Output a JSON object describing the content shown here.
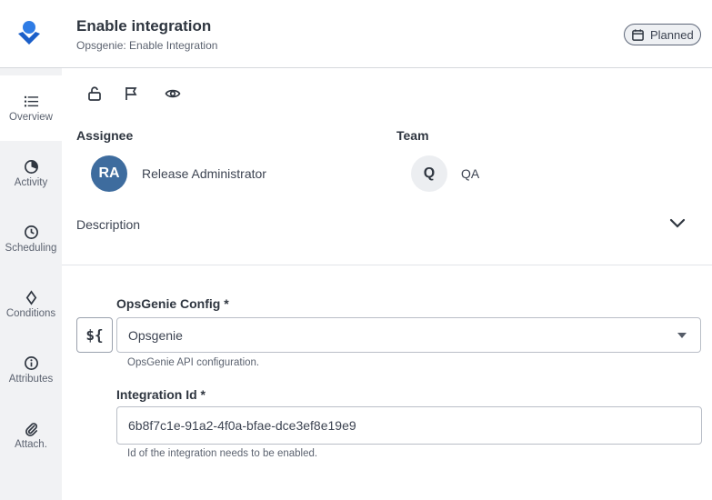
{
  "header": {
    "title": "Enable integration",
    "subtitle": "Opsgenie: Enable Integration",
    "status": "Planned",
    "logo_icon": "opsgenie-logo"
  },
  "sidebar": {
    "items": [
      {
        "label": "Overview",
        "icon": "list-icon",
        "active": true
      },
      {
        "label": "Activity",
        "icon": "pie-icon"
      },
      {
        "label": "Scheduling",
        "icon": "clock-icon"
      },
      {
        "label": "Conditions",
        "icon": "diamond-icon"
      },
      {
        "label": "Attributes",
        "icon": "info-icon"
      },
      {
        "label": "Attach.",
        "icon": "paperclip-icon"
      }
    ]
  },
  "toolbar": {
    "icons": [
      "unlock-icon",
      "flag-icon",
      "eye-icon"
    ]
  },
  "assignee": {
    "label": "Assignee",
    "initials": "RA",
    "name": "Release Administrator"
  },
  "team": {
    "label": "Team",
    "initials": "Q",
    "name": "QA"
  },
  "description": {
    "label": "Description"
  },
  "form": {
    "var_button": "${",
    "config": {
      "label": "OpsGenie Config *",
      "value": "Opsgenie",
      "help": "OpsGenie API configuration."
    },
    "integration": {
      "label": "Integration Id *",
      "value": "6b8f7c1e-91a2-4f0a-bfae-dce3ef8e19e9",
      "help": "Id of the integration needs to be enabled."
    }
  },
  "colors": {
    "brand": "#1f6feb",
    "assignee_avatar": "#3e6c9e",
    "team_avatar": "#eceef1"
  }
}
